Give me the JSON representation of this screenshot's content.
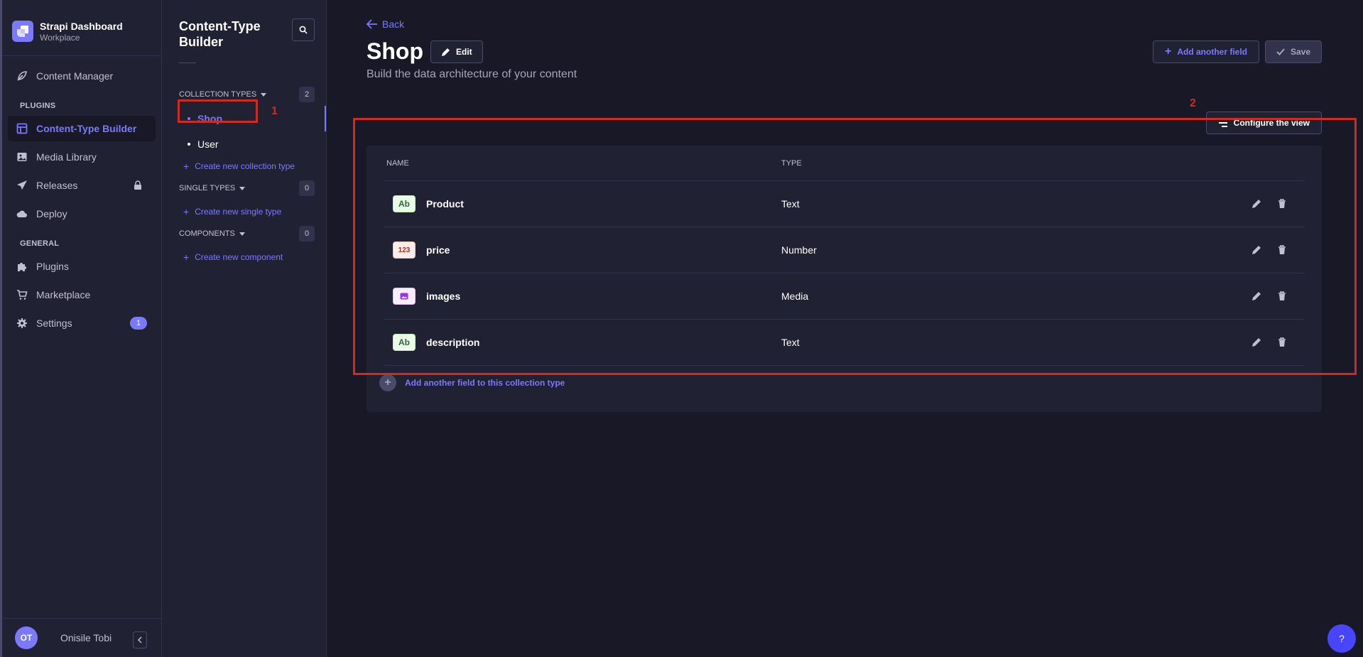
{
  "brand": {
    "title": "Strapi Dashboard",
    "subtitle": "Workplace",
    "logo_icon": "strapi-logo"
  },
  "nav": {
    "content_manager": "Content Manager",
    "plugins_section": "PLUGINS",
    "content_type_builder": "Content-Type Builder",
    "media_library": "Media Library",
    "releases": "Releases",
    "deploy": "Deploy",
    "general_section": "GENERAL",
    "plugins": "Plugins",
    "marketplace": "Marketplace",
    "settings": "Settings",
    "settings_badge": "1"
  },
  "user": {
    "initials": "OT",
    "name": "Onisile Tobi"
  },
  "subnav": {
    "title": "Content-Type Builder",
    "collection_types": {
      "label": "COLLECTION TYPES",
      "count": "2",
      "items": [
        {
          "label": "Shop"
        },
        {
          "label": "User"
        }
      ],
      "create_label": "Create new collection type"
    },
    "single_types": {
      "label": "SINGLE TYPES",
      "count": "0",
      "create_label": "Create new single type"
    },
    "components": {
      "label": "COMPONENTS",
      "count": "0",
      "create_label": "Create new component"
    }
  },
  "header": {
    "back_label": "Back",
    "title": "Shop",
    "edit_label": "Edit",
    "subtitle": "Build the data architecture of your content",
    "add_field_label": "Add another field",
    "save_label": "Save"
  },
  "configure_view_label": "Configure the view",
  "table": {
    "col_name": "NAME",
    "col_type": "TYPE",
    "rows": [
      {
        "icon": "Ab",
        "name": "Product",
        "type": "Text"
      },
      {
        "icon": "123",
        "name": "price",
        "type": "Number"
      },
      {
        "icon": "media-icon",
        "name": "images",
        "type": "Media"
      },
      {
        "icon": "Ab",
        "name": "description",
        "type": "Text"
      }
    ],
    "add_field_label": "Add another field to this collection type"
  },
  "annotations": {
    "marker_1": "1",
    "marker_2": "2"
  },
  "help_label": "?",
  "colors": {
    "accent": "#7b79ff",
    "background": "#181826",
    "panel": "#212134",
    "highlight": "#d02b20"
  }
}
